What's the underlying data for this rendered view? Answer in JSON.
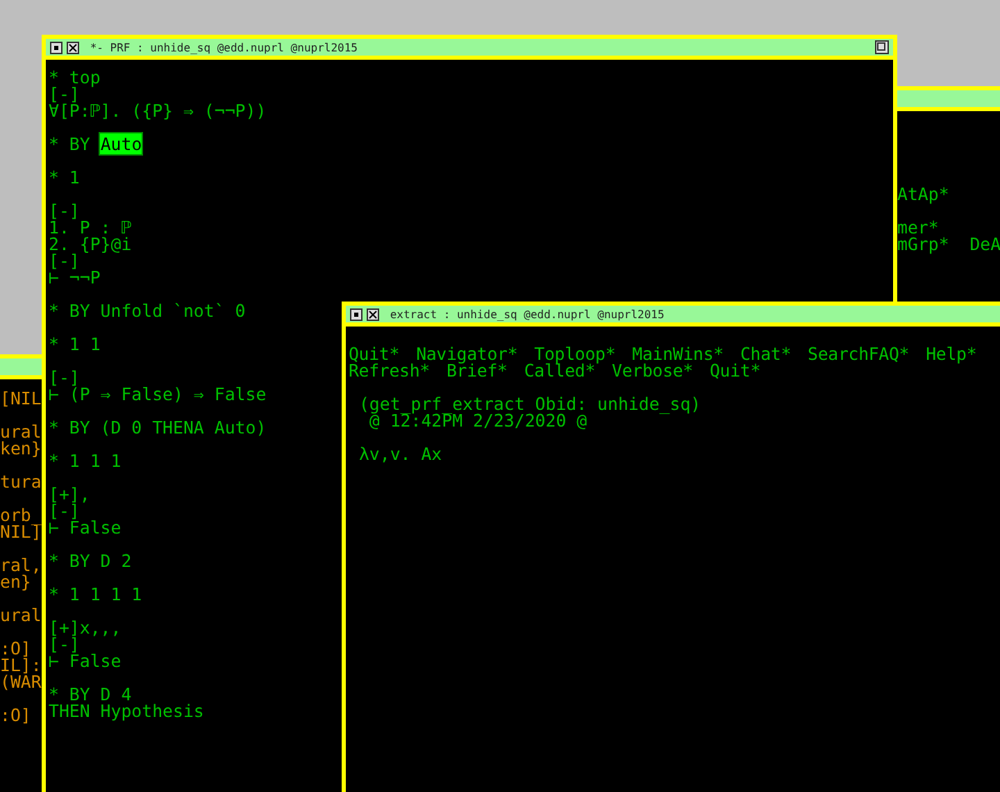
{
  "windows": [
    {
      "kind": "log",
      "blocks": [
        [
          "[NIL"
        ],
        [
          "ural",
          "ken}"
        ],
        [
          "tura"
        ],
        [
          "orb_",
          "NIL]"
        ],
        [
          "ral,",
          "en}"
        ],
        [
          "ural"
        ],
        [
          ":O]",
          "IL]:",
          "(WAR"
        ],
        [
          ":O]"
        ]
      ]
    },
    {
      "kind": "menu",
      "blocks": [
        [
          "AtAp*"
        ],
        [
          "mer*",
          "mGrp*  DeA"
        ]
      ]
    },
    {
      "kind": "proof",
      "title": "*- PRF : unhide_sq @edd.nuprl @nuprl2015",
      "blocks": [
        [
          "* top",
          "[-]",
          "∀[P:ℙ]. ({P} ⇒ (¬¬P))"
        ],
        [
          {
            "parts": [
              {
                "text": "* BY ",
                "highlighted": false
              },
              {
                "text": "Auto",
                "highlighted": true
              }
            ]
          }
        ],
        [
          "* 1"
        ],
        [
          "[-]",
          "1. P : ℙ",
          "2. {P}@i",
          "[-]",
          "⊢ ¬¬P"
        ],
        [
          "* BY Unfold `not` 0"
        ],
        [
          "* 1 1"
        ],
        [
          "[-]",
          "⊢ (P ⇒ False) ⇒ False"
        ],
        [
          "* BY (D 0 THENA Auto)"
        ],
        [
          "* 1 1 1"
        ],
        [
          "[+],",
          "[-]",
          "⊢ False"
        ],
        [
          "* BY D 2"
        ],
        [
          "* 1 1 1 1"
        ],
        [
          "[+]x,,,",
          "[-]",
          "⊢ False"
        ],
        [
          "* BY D 4",
          "THEN Hypothesis"
        ]
      ]
    },
    {
      "kind": "extract",
      "title": "extract : unhide_sq @edd.nuprl @nuprl2015",
      "menu": [
        [
          "Quit*",
          "Navigator*",
          "Toploop*",
          "MainWins*",
          "Chat*",
          "SearchFAQ*",
          "Help*"
        ],
        [
          "Refresh*",
          "Brief*",
          "Called*",
          "Verbose*",
          "Quit*"
        ]
      ],
      "blocks": [
        [
          " (get_prf_extract Obid: unhide_sq)",
          "  @ 12:42PM 2/23/2020 @"
        ],
        [
          " λv,v. Ax"
        ]
      ]
    }
  ]
}
